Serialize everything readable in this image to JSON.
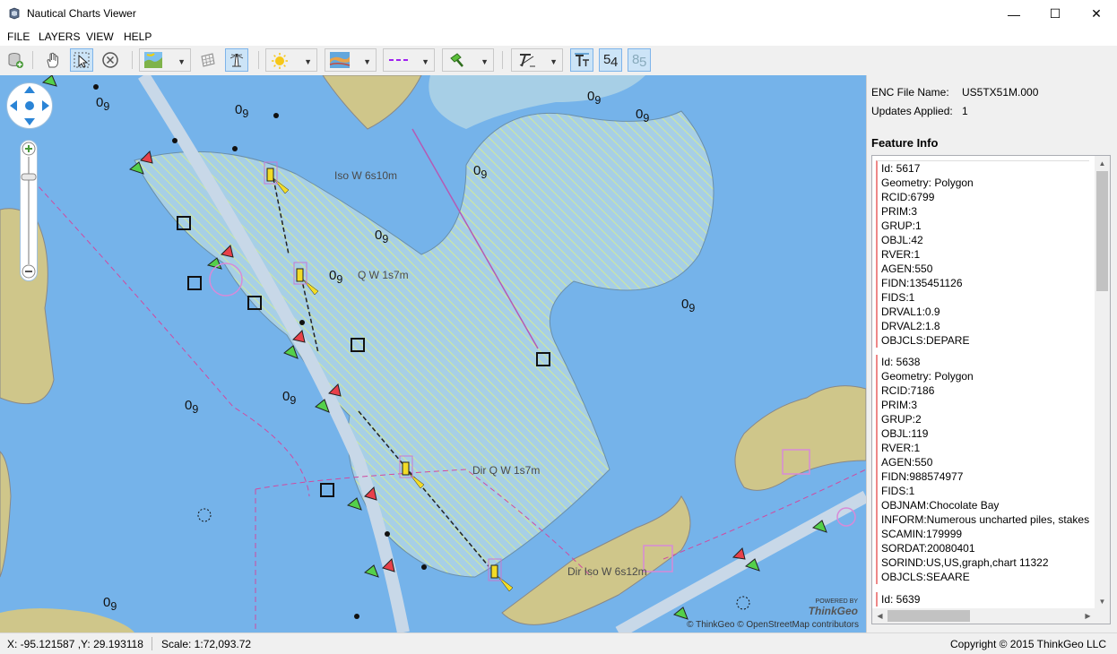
{
  "window": {
    "title": "Nautical Charts Viewer",
    "minimize_glyph": "—",
    "maximize_glyph": "☐",
    "close_glyph": "✕"
  },
  "menu": [
    "FILE",
    "LAYERS",
    "VIEW",
    "HELP"
  ],
  "toolbar": {
    "icons": [
      "add-layer-icon",
      "pan-hand-icon",
      "select-arrow-icon",
      "clear-icon",
      "base-map-icon",
      "grid-icon",
      "lighthouse-icon",
      "sun-brightness-icon",
      "chart-style-icon",
      "line-style-icon",
      "symbol-icon",
      "text-style-icon",
      "text-labels-icon",
      "depth-soundings-icon",
      "safety-contour-icon"
    ],
    "depth_values": [
      "5",
      "4"
    ],
    "safety_values": [
      "8",
      "5"
    ]
  },
  "map": {
    "light_labels": [
      "Iso W 6s10m",
      "Q W 1s7m",
      "Dir Q W 1s7m",
      "Dir Iso W 6s12m"
    ],
    "soundings_big": [
      "0",
      "9",
      "0",
      "9",
      "0",
      "9",
      "0",
      "9",
      "0",
      "9",
      "0",
      "9",
      "0",
      "9",
      "0",
      "9",
      "0",
      "9",
      "0",
      "9",
      "0",
      "9"
    ],
    "attribution": "© ThinkGeo © OpenStreetMap contributors",
    "powered_by": "POWERED BY",
    "powered_brand": "ThinkGeo"
  },
  "panel": {
    "enc_label": "ENC File Name:",
    "enc_value": "US5TX51M.000",
    "updates_label": "Updates Applied:",
    "updates_value": "1",
    "heading": "Feature Info",
    "records": [
      {
        "lines": [
          "Id: 5617",
          "Geometry: Polygon",
          "RCID:6799",
          "PRIM:3",
          "GRUP:1",
          "OBJL:42",
          "RVER:1",
          "AGEN:550",
          "FIDN:135451126",
          "FIDS:1",
          "DRVAL1:0.9",
          "DRVAL2:1.8",
          "OBJCLS:DEPARE"
        ]
      },
      {
        "lines": [
          "Id: 5638",
          "Geometry: Polygon",
          "RCID:7186",
          "PRIM:3",
          "GRUP:2",
          "OBJL:119",
          "RVER:1",
          "AGEN:550",
          "FIDN:988574977",
          "FIDS:1",
          "OBJNAM:Chocolate Bay",
          "INFORM:Numerous uncharted piles, stakes,",
          "SCAMIN:179999",
          "SORDAT:20080401",
          "SORIND:US,US,graph,chart 11322",
          "OBJCLS:SEAARE"
        ]
      },
      {
        "lines": [
          "Id: 5639"
        ]
      }
    ]
  },
  "status": {
    "coords": "X:  -95.121587 ,Y:  29.193118",
    "scale": "Scale: 1:72,093.72",
    "copyright": "Copyright © 2015 ThinkGeo LLC"
  }
}
